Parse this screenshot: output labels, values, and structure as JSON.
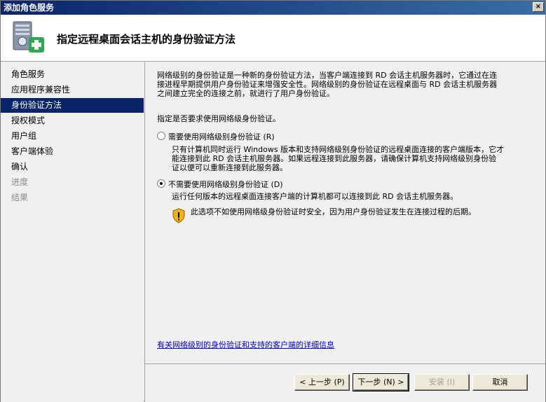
{
  "window": {
    "title": "添加角色服务",
    "close_label": "×"
  },
  "header": {
    "title": "指定远程桌面会话主机的身份验证方法"
  },
  "sidebar": {
    "items": [
      {
        "label": "角色服务",
        "state": "normal"
      },
      {
        "label": "应用程序兼容性",
        "state": "normal"
      },
      {
        "label": "身份验证方法",
        "state": "active"
      },
      {
        "label": "授权模式",
        "state": "normal"
      },
      {
        "label": "用户组",
        "state": "normal"
      },
      {
        "label": "客户端体验",
        "state": "normal"
      },
      {
        "label": "确认",
        "state": "normal"
      },
      {
        "label": "进度",
        "state": "disabled"
      },
      {
        "label": "结果",
        "state": "disabled"
      }
    ]
  },
  "content": {
    "intro_line1": "网络级别的身份验证是一种新的身份验证方法，当客户端连接到 RD 会话主机服务器时，它通过在连",
    "intro_line2": "接进程早期提供用户身份验证来增强安全性。网络级别的身份验证在远程桌面与 RD 会话主机服务器",
    "intro_line3": "之间建立完全的连接之前，就进行了用户身份验证。",
    "prompt": "指定是否要求使用网络级身份验证。",
    "option1": {
      "label": "需要使用网络级别身份验证 (R)",
      "checked": false,
      "desc_line1": "只有计算机同时运行 Windows 版本和支持网络级别身份验证的远程桌面连接的客户端版本，它才",
      "desc_line2": "能连接到此 RD 会话主机服务器。如果远程连接到此服务器，请确保计算机支持网络级别身份验",
      "desc_line3": "证以便可以重新连接到此服务器。"
    },
    "option2": {
      "label": "不需要使用网络级别身份验证 (D)",
      "checked": true,
      "desc_line1": "运行任何版本的远程桌面连接客户端的计算机都可以连接到此 RD 会话主机服务器。",
      "warning": "此选项不如使用网络级身份验证时安全，因为用户身份验证发生在连接过程的后期。"
    },
    "link": "有关网络级别的身份验证和支持的客户端的详细信息"
  },
  "footer": {
    "back_label": "< 上一步 (P)",
    "next_label": "下一步 (N) >",
    "install_label": "安装 (I)",
    "cancel_label": "取消"
  },
  "icons": {
    "header": "server-add-icon",
    "warning": "shield-warning-icon"
  }
}
